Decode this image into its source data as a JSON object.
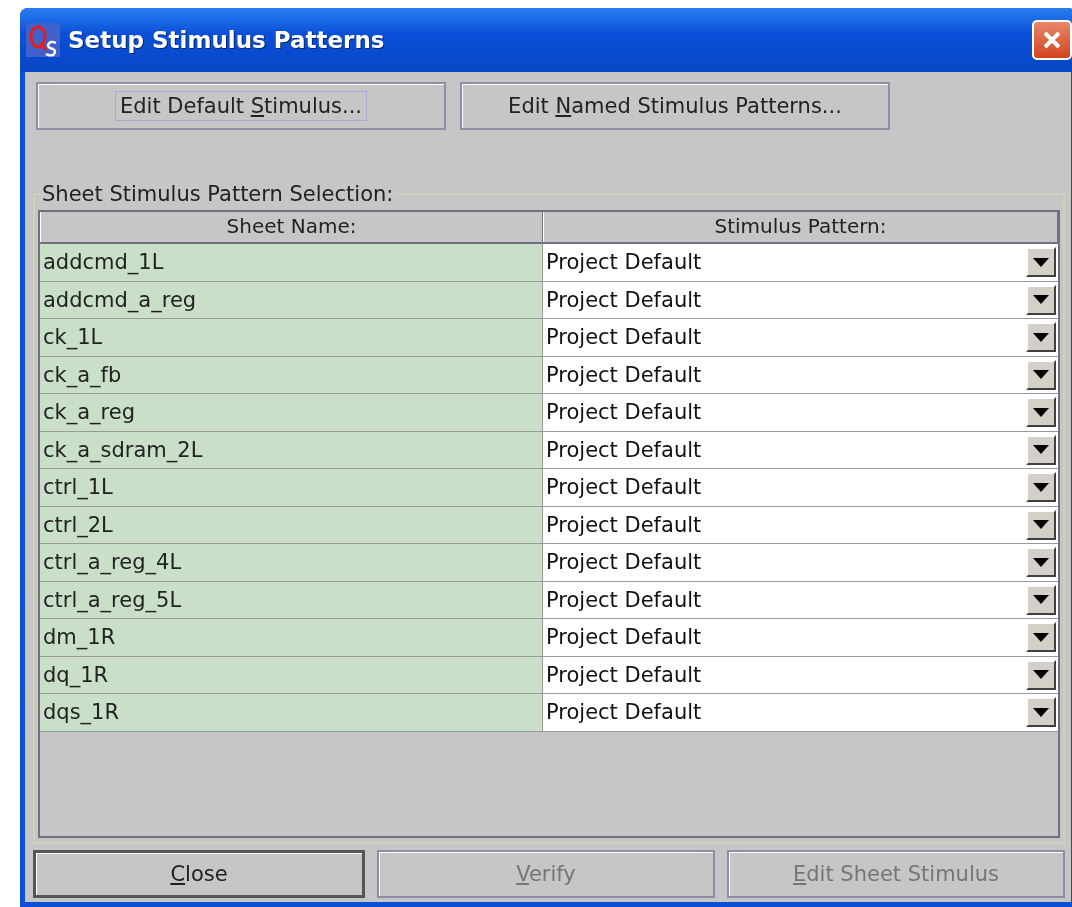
{
  "window": {
    "title": "Setup Stimulus Patterns"
  },
  "top_buttons": [
    {
      "before": "Edit Default ",
      "mnemonic": "S",
      "after": "timulus...",
      "focused": true,
      "disabled": false
    },
    {
      "before": "Edit ",
      "mnemonic": "N",
      "after": "amed Stimulus Patterns...",
      "focused": false,
      "disabled": false
    }
  ],
  "group": {
    "title": "Sheet Stimulus Pattern Selection:"
  },
  "table": {
    "columns": [
      "Sheet Name:",
      "Stimulus Pattern:"
    ],
    "rows": [
      {
        "sheet": "addcmd_1L",
        "pattern": "Project Default"
      },
      {
        "sheet": "addcmd_a_reg",
        "pattern": "Project Default"
      },
      {
        "sheet": "ck_1L",
        "pattern": "Project Default"
      },
      {
        "sheet": "ck_a_fb",
        "pattern": "Project Default"
      },
      {
        "sheet": "ck_a_reg",
        "pattern": "Project Default"
      },
      {
        "sheet": "ck_a_sdram_2L",
        "pattern": "Project Default"
      },
      {
        "sheet": "ctrl_1L",
        "pattern": "Project Default"
      },
      {
        "sheet": "ctrl_2L",
        "pattern": "Project Default"
      },
      {
        "sheet": "ctrl_a_reg_4L",
        "pattern": "Project Default"
      },
      {
        "sheet": "ctrl_a_reg_5L",
        "pattern": "Project Default"
      },
      {
        "sheet": "dm_1R",
        "pattern": "Project Default"
      },
      {
        "sheet": "dq_1R",
        "pattern": "Project Default"
      },
      {
        "sheet": "dqs_1R",
        "pattern": "Project Default"
      }
    ]
  },
  "bottom_buttons": [
    {
      "mnemonic": "C",
      "after": "lose",
      "focused": true,
      "disabled": false
    },
    {
      "mnemonic": "V",
      "after": "erify",
      "focused": false,
      "disabled": true
    },
    {
      "mnemonic": "E",
      "after": "dit Sheet Stimulus",
      "focused": false,
      "disabled": true
    }
  ]
}
